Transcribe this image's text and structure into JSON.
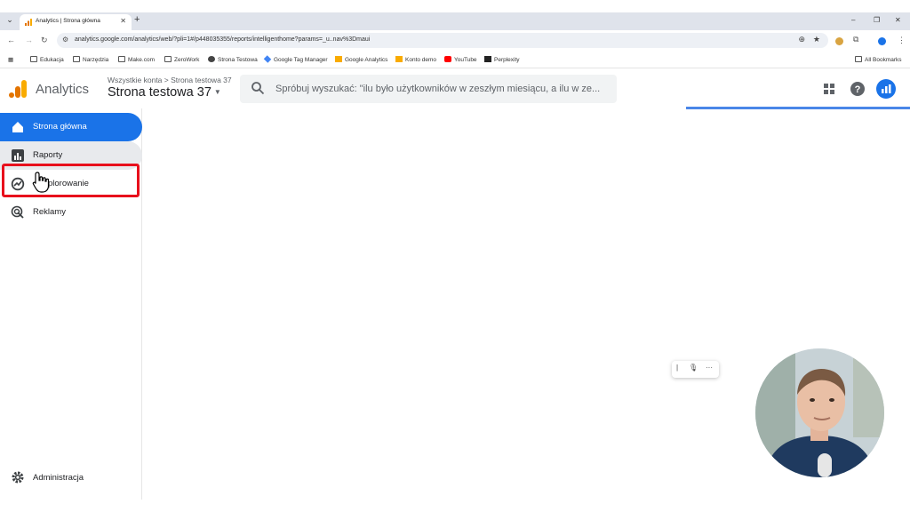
{
  "browser": {
    "tab_title": "Analytics | Strona główna",
    "url": "analytics.google.com/analytics/web/?pli=1#/p448035355/reports/intelligenthome?params=_u..nav%3Dmaui",
    "bookmarks": [
      {
        "label": "Edukacja",
        "icon": "folder-icon"
      },
      {
        "label": "Narzędzia",
        "icon": "folder-icon"
      },
      {
        "label": "Make.com",
        "icon": "folder-icon"
      },
      {
        "label": "ZeroWork",
        "icon": "folder-icon"
      },
      {
        "label": "Strona Testowa",
        "icon": "globe-icon"
      },
      {
        "label": "Google Tag Manager",
        "icon": "gtm-icon"
      },
      {
        "label": "Google Analytics",
        "icon": "analytics-icon"
      },
      {
        "label": "Konto demo",
        "icon": "analytics-icon"
      },
      {
        "label": "YouTube",
        "icon": "youtube-icon"
      },
      {
        "label": "Perplexity",
        "icon": "perplexity-icon"
      }
    ],
    "all_bookmarks": "All Bookmarks"
  },
  "header": {
    "app_name": "Analytics",
    "breadcrumb": "Wszystkie konta > Strona testowa 37",
    "property": "Strona testowa 37",
    "search_placeholder": "Spróbuj wyszukać: \"ilu było użytkowników w zeszłym miesiącu, a ilu w ze..."
  },
  "sidebar": {
    "items": [
      {
        "label": "Strona główna",
        "icon": "home-icon",
        "active": true
      },
      {
        "label": "Raporty",
        "icon": "bar-chart-icon"
      },
      {
        "label": "Eksplorowanie",
        "visible_label": "plorowanie",
        "icon": "explore-icon"
      },
      {
        "label": "Reklamy",
        "icon": "advertising-icon"
      }
    ],
    "admin_label": "Administracja"
  },
  "colors": {
    "accent": "#1a73e8",
    "annotation": "#e8101c",
    "loading_bar": "#4a86e8"
  }
}
